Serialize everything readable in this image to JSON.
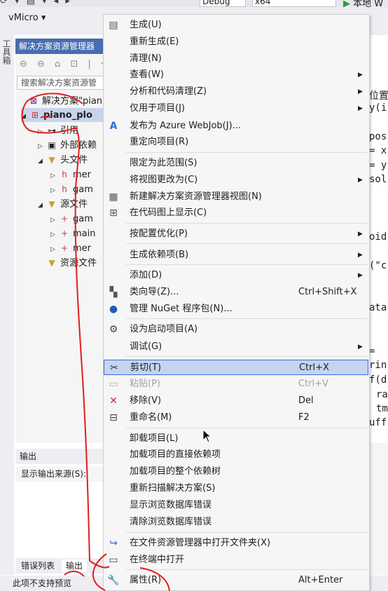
{
  "toolbar": {
    "icons": "⟳ ▾ ▤ ▾ ◂ ▸",
    "config": "Debug",
    "platform": "x64",
    "run_label": "本地 W",
    "extension_menu": "vMicro ▾"
  },
  "toolbox": {
    "label": "工具箱"
  },
  "solution_explorer": {
    "title": "解决方案资源管理器",
    "tool_icons": "⊖ ⊖ ⌂ ⊡ | ⟲",
    "search_placeholder": "搜索解决方案资源管",
    "solution_label": "解决方案\"pian",
    "project_label": "piano_plo",
    "items": [
      {
        "label": "引用"
      },
      {
        "label": "外部依赖"
      },
      {
        "label": "头文件"
      },
      {
        "label": "mer"
      },
      {
        "label": "gam"
      },
      {
        "label": "源文件"
      },
      {
        "label": "gam"
      },
      {
        "label": "main"
      },
      {
        "label": "mer"
      },
      {
        "label": "资源文件"
      }
    ]
  },
  "code_lines": [
    "位置",
    "y(i",
    "pos",
    "= x",
    "= y",
    "sol",
    "oid",
    "(\"c",
    "ata",
    "=",
    "rin",
    "f(d",
    "ra",
    "tm",
    "uff"
  ],
  "output": {
    "title": "输出",
    "source_label": "显示输出来源(S):"
  },
  "bottom_tabs": {
    "errors": "错误列表",
    "output": "输出"
  },
  "status": {
    "text": "此项不支持预览"
  },
  "context_menu": {
    "items": [
      {
        "label": "生成(U)",
        "shortcut": "",
        "icon": "build-icon"
      },
      {
        "label": "重新生成(E)",
        "shortcut": ""
      },
      {
        "label": "清理(N)",
        "shortcut": ""
      },
      {
        "label": "查看(W)",
        "shortcut": "",
        "submenu": true
      },
      {
        "label": "分析和代码清理(Z)",
        "shortcut": "",
        "submenu": true
      },
      {
        "label": "仅用于项目(J)",
        "shortcut": "",
        "submenu": true
      },
      {
        "label": "发布为 Azure WebJob(J)...",
        "shortcut": "",
        "icon": "azure-icon"
      },
      {
        "label": "重定向项目(R)",
        "shortcut": ""
      },
      {
        "label": "限定为此范围(S)",
        "shortcut": ""
      },
      {
        "label": "将视图更改为(C)",
        "shortcut": "",
        "submenu": true
      },
      {
        "label": "新建解决方案资源管理器视图(N)",
        "shortcut": "",
        "icon": "new-view-icon"
      },
      {
        "label": "在代码图上显示(C)",
        "shortcut": "",
        "icon": "code-map-icon"
      },
      {
        "label": "按配置优化(P)",
        "shortcut": "",
        "submenu": true
      },
      {
        "label": "生成依赖项(B)",
        "shortcut": "",
        "submenu": true
      },
      {
        "label": "添加(D)",
        "shortcut": "",
        "submenu": true
      },
      {
        "label": "类向导(Z)...",
        "shortcut": "Ctrl+Shift+X",
        "icon": "class-wizard-icon"
      },
      {
        "label": "管理 NuGet 程序包(N)...",
        "shortcut": "",
        "icon": "nuget-icon"
      },
      {
        "label": "设为启动项目(A)",
        "shortcut": "",
        "icon": "gear-icon"
      },
      {
        "label": "调试(G)",
        "shortcut": "",
        "submenu": true
      },
      {
        "label": "剪切(T)",
        "shortcut": "Ctrl+X",
        "icon": "scissors-icon"
      },
      {
        "label": "粘贴(P)",
        "shortcut": "Ctrl+V",
        "icon": "paste-icon"
      },
      {
        "label": "移除(V)",
        "shortcut": "Del",
        "icon": "remove-icon"
      },
      {
        "label": "重命名(M)",
        "shortcut": "F2",
        "icon": "rename-icon"
      },
      {
        "label": "卸载项目(L)",
        "shortcut": ""
      },
      {
        "label": "加载项目的直接依赖项",
        "shortcut": ""
      },
      {
        "label": "加载项目的整个依赖树",
        "shortcut": ""
      },
      {
        "label": "重新扫描解决方案(S)",
        "shortcut": ""
      },
      {
        "label": "显示浏览数据库错误",
        "shortcut": ""
      },
      {
        "label": "清除浏览数据库错误",
        "shortcut": ""
      },
      {
        "label": "在文件资源管理器中打开文件夹(X)",
        "shortcut": "",
        "icon": "open-folder-icon"
      },
      {
        "label": "在终端中打开",
        "shortcut": "",
        "icon": "terminal-icon"
      },
      {
        "label": "属性(R)",
        "shortcut": "Alt+Enter",
        "icon": "wrench-icon"
      }
    ]
  },
  "colors": {
    "accent": "#4a6cb0",
    "highlight_bg": "#c5d4ef",
    "highlight_border": "#3c6bd8",
    "annotation_red": "#e11d1d"
  }
}
